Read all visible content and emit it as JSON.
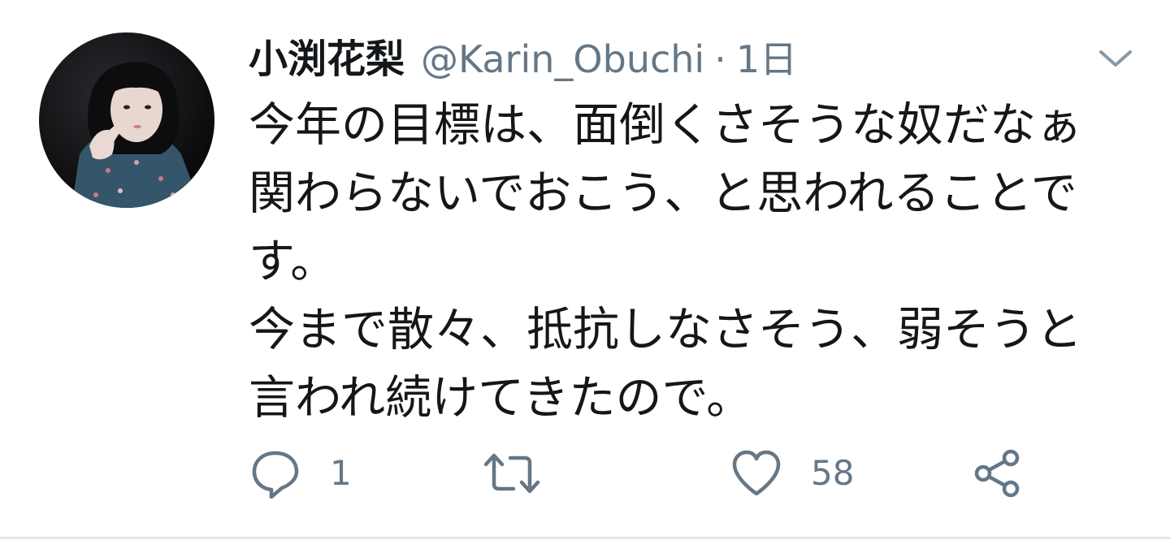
{
  "tweet": {
    "author": {
      "display_name": "小渕花梨",
      "handle": "@Karin_Obuchi",
      "avatar": "profile-photo"
    },
    "separator": "·",
    "timestamp": "1日",
    "body_lines": [
      "今年の目標は、面倒くさそうな奴だなぁ",
      "関わらないでおこう、と思われることで",
      "す。",
      "今まで散々、抵抗しなさそう、弱そうと",
      "言われ続けてきたので。"
    ],
    "actions": {
      "reply": {
        "icon": "reply-icon",
        "count": "1"
      },
      "retweet": {
        "icon": "retweet-icon",
        "count": ""
      },
      "like": {
        "icon": "heart-icon",
        "count": "58"
      },
      "share": {
        "icon": "share-icon"
      }
    },
    "menu_icon": "chevron-down-icon"
  },
  "colors": {
    "text_primary": "#14171a",
    "text_secondary": "#657786",
    "divider": "#e1e8ed"
  }
}
